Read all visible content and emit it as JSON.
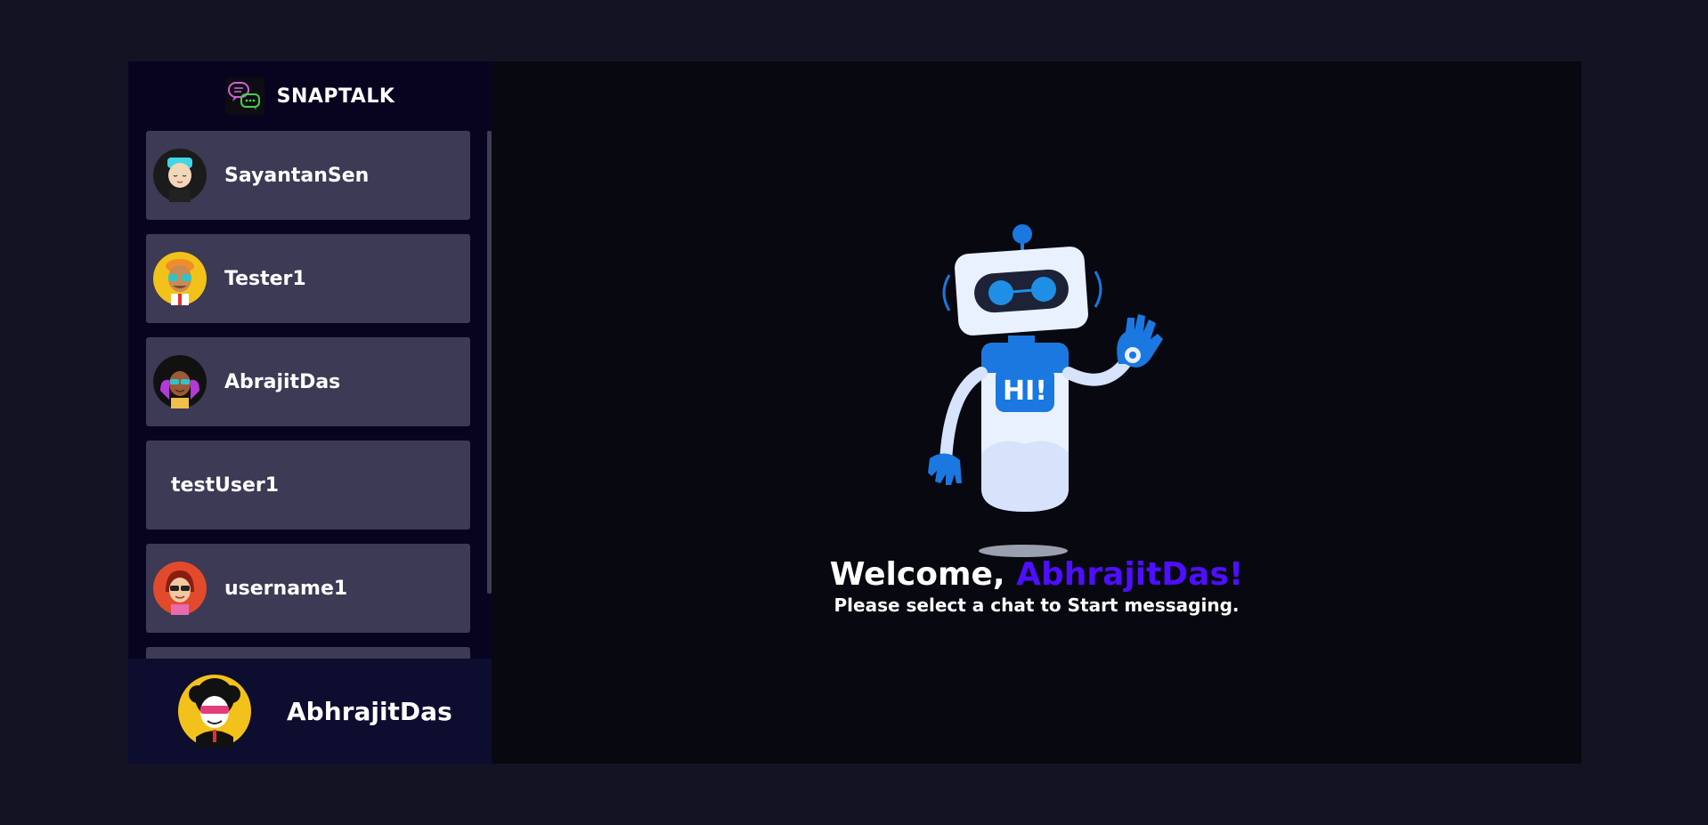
{
  "brand": {
    "name": "SNAPTALK",
    "logo_icon": "chat-bubbles-icon"
  },
  "contacts": [
    {
      "name": "SayantanSen",
      "avatar": "avatar-cyan-hair",
      "has_avatar": true
    },
    {
      "name": "Tester1",
      "avatar": "avatar-sunglasses-yellow",
      "has_avatar": true
    },
    {
      "name": "AbrajitDas",
      "avatar": "avatar-afro-purple",
      "has_avatar": true
    },
    {
      "name": "testUser1",
      "avatar": "",
      "has_avatar": false
    },
    {
      "name": "username1",
      "avatar": "avatar-red-hair",
      "has_avatar": true
    }
  ],
  "current_user": {
    "name": "AbhrajitDas",
    "avatar": "avatar-afro-sunglasses"
  },
  "welcome": {
    "prefix": "Welcome, ",
    "username": "AbhrajitDas!",
    "subtitle": "Please select a chat to Start messaging.",
    "robot_badge": "HI!"
  },
  "colors": {
    "page_bg": "#131324",
    "sidebar_bg": "#080420",
    "contact_bg": "#3c3a54",
    "accent": "#4e0eff"
  }
}
